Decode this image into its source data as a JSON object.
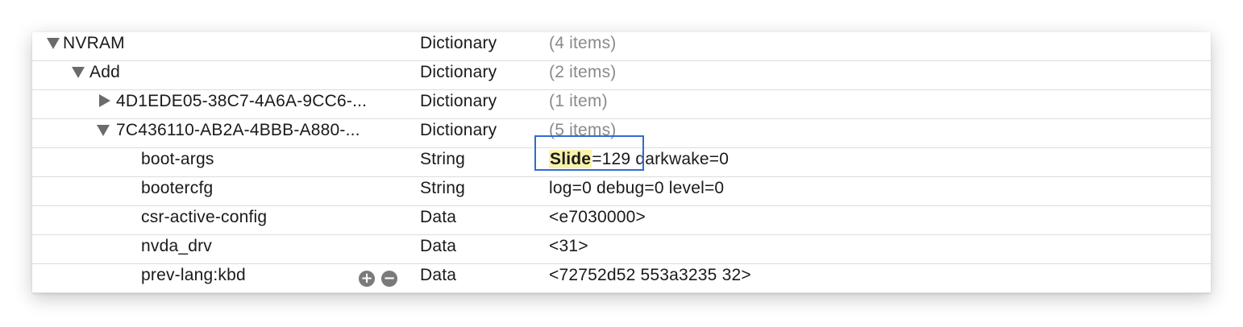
{
  "rows": [
    {
      "key": "NVRAM",
      "type": "Dictionary",
      "value": "(4 items)",
      "disclosure": "expanded",
      "depth": 0
    },
    {
      "key": "Add",
      "type": "Dictionary",
      "value": "(2 items)",
      "disclosure": "expanded",
      "depth": 1
    },
    {
      "key": "4D1EDE05-38C7-4A6A-9CC6-...",
      "type": "Dictionary",
      "value": "(1 item)",
      "disclosure": "collapsed",
      "depth": 2
    },
    {
      "key": "7C436110-AB2A-4BBB-A880-...",
      "type": "Dictionary",
      "value": "(5 items)",
      "disclosure": "expanded",
      "depth": 2
    },
    {
      "key": "boot-args",
      "type": "String",
      "value_highlight": "Slide",
      "value_rest": "=129 darkwake=0"
    },
    {
      "key": "bootercfg",
      "type": "String",
      "value": "log=0 debug=0 level=0"
    },
    {
      "key": "csr-active-config",
      "type": "Data",
      "value": "<e7030000>"
    },
    {
      "key": "nvda_drv",
      "type": "Data",
      "value": "<31>"
    },
    {
      "key": "prev-lang:kbd",
      "type": "Data",
      "value": "<72752d52 553a3235 32>"
    }
  ],
  "row_buttons": {
    "add_icon": "plus-circle-icon",
    "remove_icon": "minus-circle-icon",
    "add_label": "+",
    "remove_label": "−"
  },
  "colors": {
    "highlight": "#fbf3ad",
    "selection_border": "#2f6bd6",
    "muted_text": "#8a8a8a"
  }
}
